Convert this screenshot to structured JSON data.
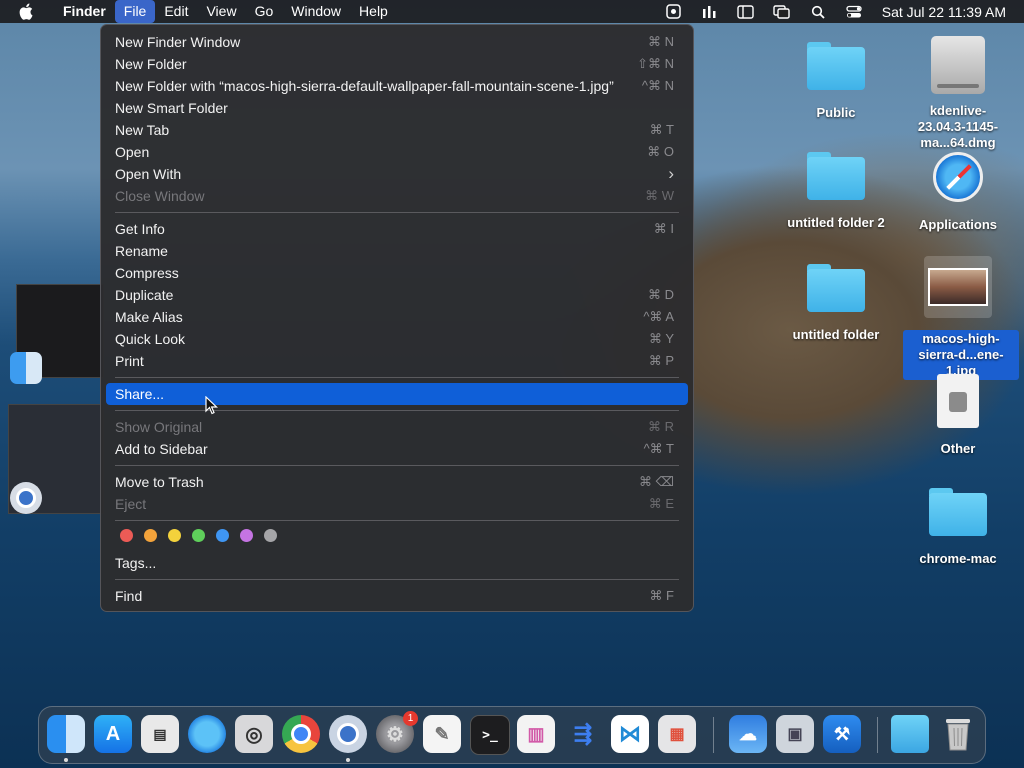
{
  "menubar": {
    "app_name": "Finder",
    "menus": [
      "File",
      "Edit",
      "View",
      "Go",
      "Window",
      "Help"
    ],
    "clock": "Sat Jul 22  11:39 AM",
    "status_icons": [
      "screen-recording-icon",
      "stats-icon",
      "sidebar-icon",
      "screen-mirroring-icon",
      "search-icon",
      "control-center-icon"
    ]
  },
  "file_menu": {
    "items": [
      {
        "label": "New Finder Window",
        "shortcut": "⌘ N"
      },
      {
        "label": "New Folder",
        "shortcut": "⇧⌘ N"
      },
      {
        "label": "New Folder with “macos-high-sierra-default-wallpaper-fall-mountain-scene-1.jpg”",
        "shortcut": "^⌘ N"
      },
      {
        "label": "New Smart Folder",
        "shortcut": ""
      },
      {
        "label": "New Tab",
        "shortcut": "⌘ T"
      },
      {
        "label": "Open",
        "shortcut": "⌘ O"
      },
      {
        "label": "Open With",
        "shortcut": "›"
      },
      {
        "label": "Close Window",
        "shortcut": "⌘ W"
      },
      {
        "label": "Get Info",
        "shortcut": "⌘ I"
      },
      {
        "label": "Rename",
        "shortcut": ""
      },
      {
        "label": "Compress",
        "shortcut": ""
      },
      {
        "label": "Duplicate",
        "shortcut": "⌘ D"
      },
      {
        "label": "Make Alias",
        "shortcut": "^⌘ A"
      },
      {
        "label": "Quick Look",
        "shortcut": "⌘ Y"
      },
      {
        "label": "Print",
        "shortcut": "⌘ P"
      },
      {
        "label": "Share...",
        "shortcut": ""
      },
      {
        "label": "Show Original",
        "shortcut": "⌘ R"
      },
      {
        "label": "Add to Sidebar",
        "shortcut": "^⌘ T"
      },
      {
        "label": "Move to Trash",
        "shortcut": "⌘ ⌫"
      },
      {
        "label": "Eject",
        "shortcut": "⌘ E"
      },
      {
        "label": "Tags...",
        "shortcut": ""
      },
      {
        "label": "Find",
        "shortcut": "⌘ F"
      }
    ],
    "tag_colors": [
      "#ec5b56",
      "#f3a33b",
      "#f3d23c",
      "#5fcf5b",
      "#3f96f3",
      "#c574e3",
      "#a5a5a8"
    ]
  },
  "desktop_icons": [
    {
      "label": "Public"
    },
    {
      "label": "kdenlive-23.04.3-1145-ma...64.dmg"
    },
    {
      "label": "untitled folder 2"
    },
    {
      "label": "Applications"
    },
    {
      "label": "untitled folder"
    },
    {
      "label": "macos-high-sierra-d...ene-1.jpg"
    },
    {
      "label": "Other"
    },
    {
      "label": "chrome-mac"
    }
  ],
  "dock": {
    "apps": [
      "finder-icon",
      "app-store-icon",
      "activity-icon",
      "safari-icon",
      "screenshot-icon",
      "chrome-icon",
      "chromium-icon",
      "system-preferences-icon",
      "textedit-icon",
      "terminal-icon",
      "columns-icon",
      "instruments-icon",
      "vscode-icon",
      "launchpad-icon",
      "weather-icon",
      "preview-icon",
      "xcode-icon",
      "downloads-folder-icon",
      "trash-icon"
    ],
    "sys_prefs_badge": "1"
  }
}
